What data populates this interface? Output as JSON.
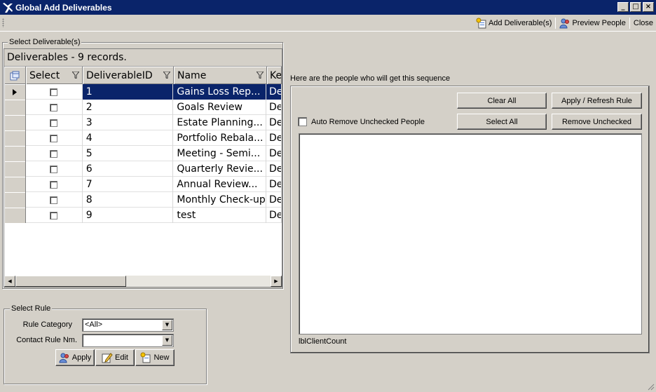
{
  "window": {
    "title": "Global Add Deliverables",
    "buttons": [
      "_",
      "□",
      "×"
    ]
  },
  "toolbar": {
    "add_label": "Add Deliverable(s)",
    "preview_label": "Preview People",
    "close_label": "Close"
  },
  "select_group": {
    "label": "Select Deliverable(s)"
  },
  "grid": {
    "caption": "Deliverables - 9 records.",
    "columns": [
      "Select",
      "DeliverableID",
      "Name",
      "Ke"
    ],
    "rows": [
      {
        "id": "1",
        "name": "Gains Loss Rep...",
        "key": "De"
      },
      {
        "id": "2",
        "name": "Goals Review",
        "key": "De"
      },
      {
        "id": "3",
        "name": "Estate Planning...",
        "key": "De"
      },
      {
        "id": "4",
        "name": "Portfolio Rebala...",
        "key": "De"
      },
      {
        "id": "5",
        "name": "Meeting - Semi...",
        "key": "De"
      },
      {
        "id": "6",
        "name": "Quarterly Revie...",
        "key": "De"
      },
      {
        "id": "7",
        "name": "Annual Review...",
        "key": "De"
      },
      {
        "id": "8",
        "name": "Monthly Check-up",
        "key": "De"
      },
      {
        "id": "9",
        "name": "test",
        "key": "De"
      }
    ],
    "selected_row": "1"
  },
  "people_panel": {
    "label": "Here are the people who will get this sequence",
    "clear_all": "Clear All",
    "apply_refresh": "Apply / Refresh Rule",
    "select_all": "Select All",
    "remove_unchecked": "Remove Unchecked",
    "auto_remove": "Auto Remove Unchecked People",
    "count_label": "lblClientCount"
  },
  "rule_group": {
    "label": "Select Rule",
    "category_label": "Rule Category",
    "category_value": "<All>",
    "contact_label": "Contact Rule Nm.",
    "contact_value": "",
    "apply_label": "Apply",
    "edit_label": "Edit",
    "new_label": "New"
  },
  "colors": {
    "titlebar": "#0a246a",
    "face": "#d4d0c8",
    "selection": "#0a246a"
  }
}
